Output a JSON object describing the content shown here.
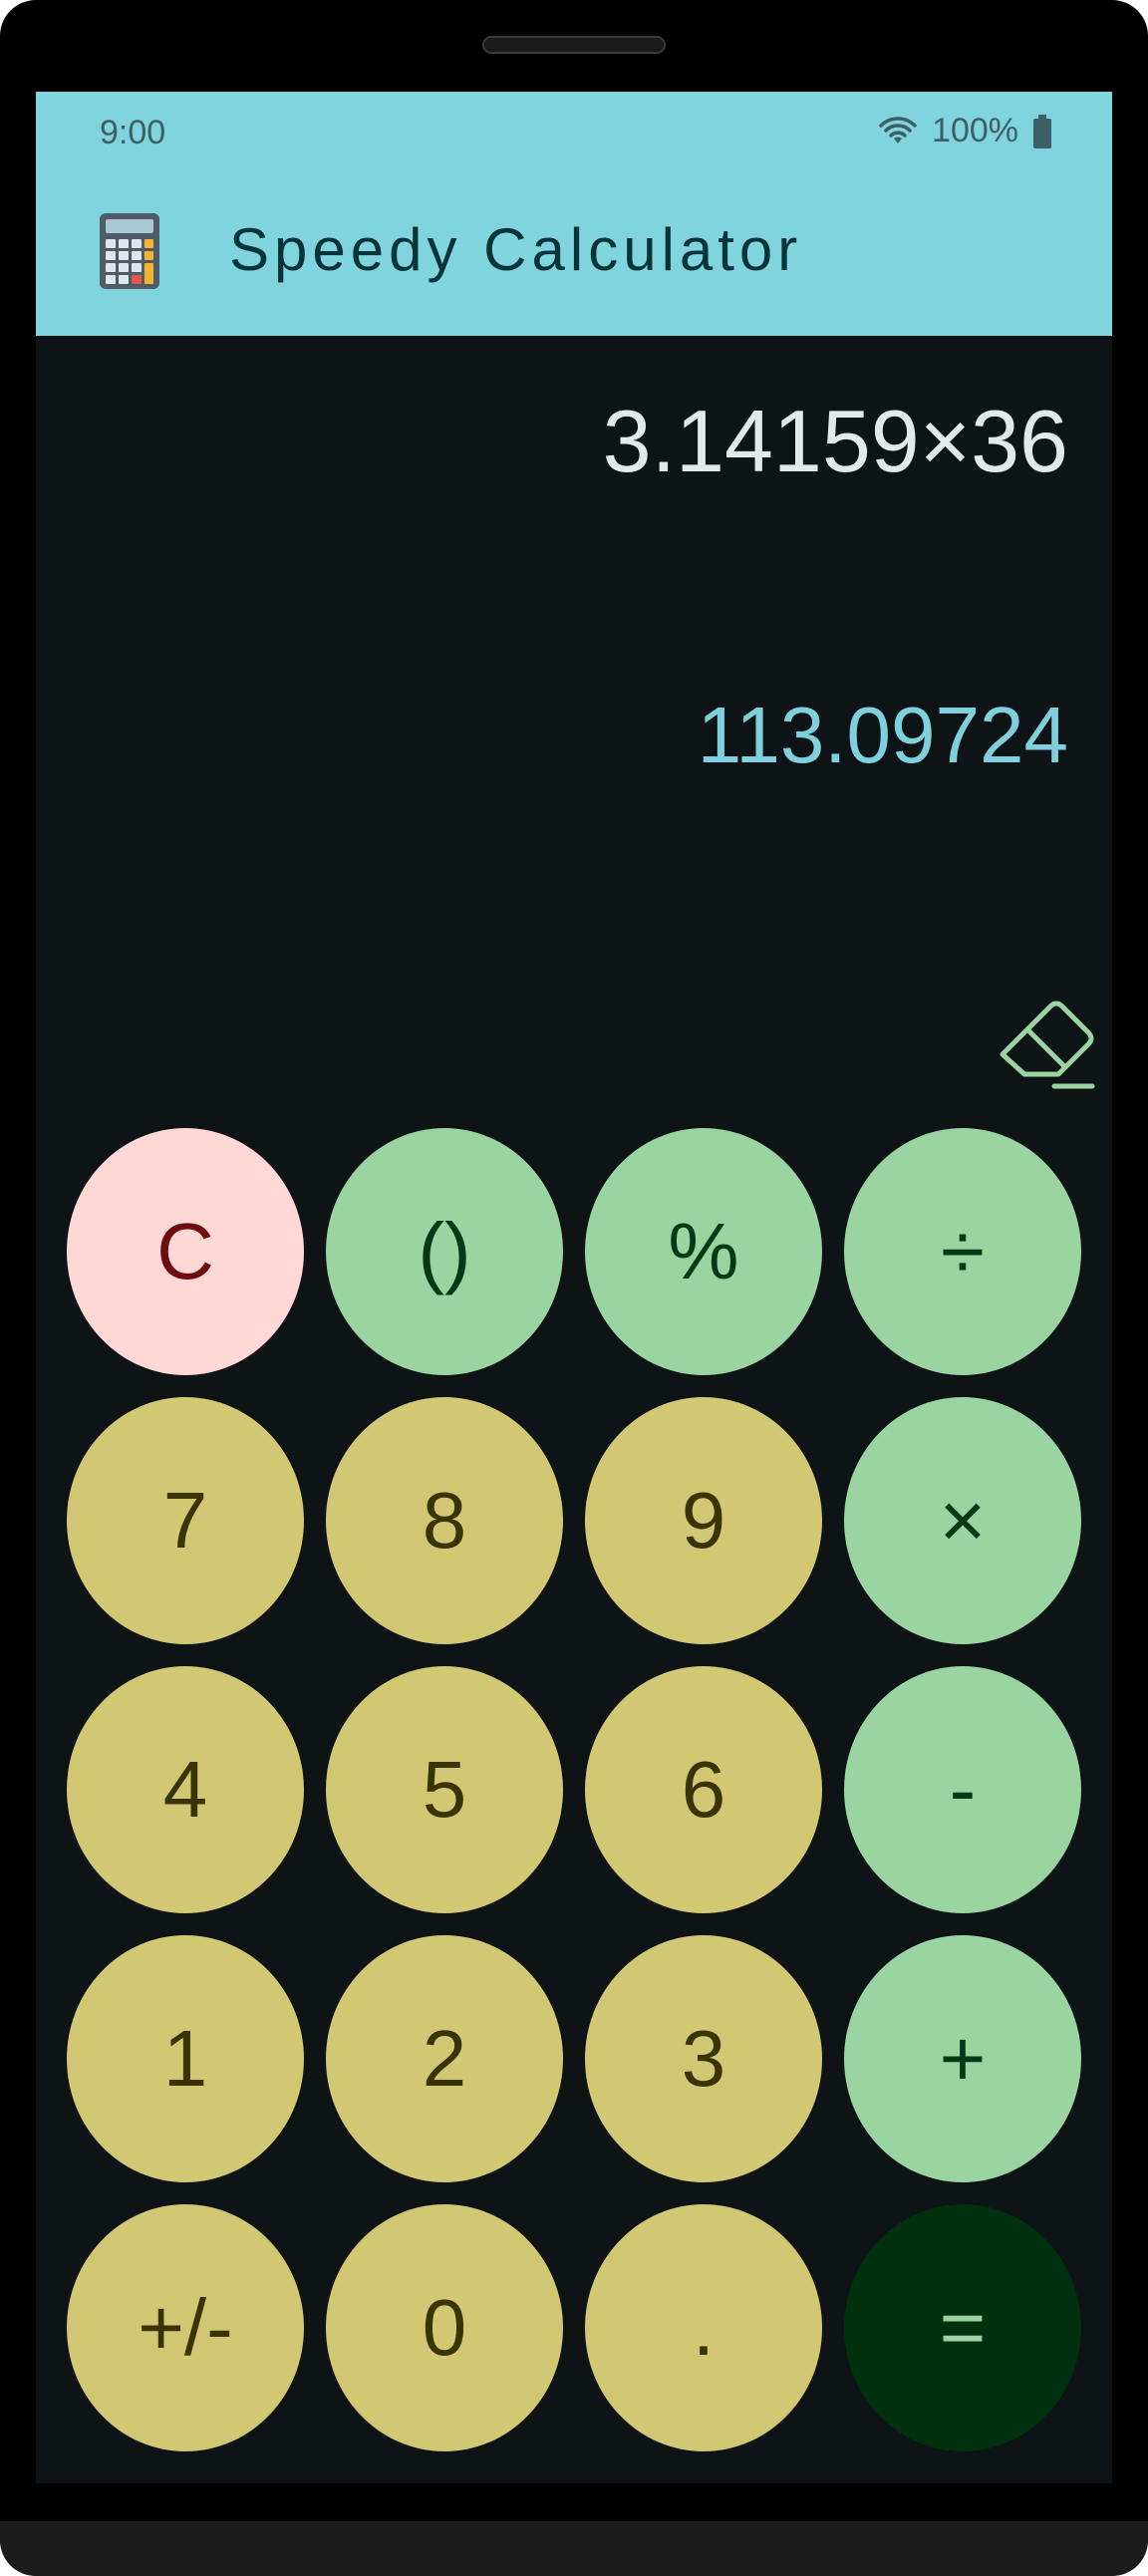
{
  "status_bar": {
    "time": "9:00",
    "battery": "100%"
  },
  "app_bar": {
    "title": "Speedy Calculator",
    "icon": "calculator-icon"
  },
  "display": {
    "expression": "3.14159×36",
    "result": "113.09724",
    "backspace_icon": "eraser-icon"
  },
  "keypad": {
    "rows": [
      [
        {
          "label": "C",
          "kind": "clear",
          "name": "clear-button"
        },
        {
          "label": "()",
          "kind": "op",
          "name": "parentheses-button"
        },
        {
          "label": "%",
          "kind": "op",
          "name": "percent-button"
        },
        {
          "label": "÷",
          "kind": "op",
          "name": "divide-button"
        }
      ],
      [
        {
          "label": "7",
          "kind": "num",
          "name": "digit-7-button"
        },
        {
          "label": "8",
          "kind": "num",
          "name": "digit-8-button"
        },
        {
          "label": "9",
          "kind": "num",
          "name": "digit-9-button"
        },
        {
          "label": "×",
          "kind": "op",
          "name": "multiply-button"
        }
      ],
      [
        {
          "label": "4",
          "kind": "num",
          "name": "digit-4-button"
        },
        {
          "label": "5",
          "kind": "num",
          "name": "digit-5-button"
        },
        {
          "label": "6",
          "kind": "num",
          "name": "digit-6-button"
        },
        {
          "label": "-",
          "kind": "op",
          "name": "subtract-button"
        }
      ],
      [
        {
          "label": "1",
          "kind": "num",
          "name": "digit-1-button"
        },
        {
          "label": "2",
          "kind": "num",
          "name": "digit-2-button"
        },
        {
          "label": "3",
          "kind": "num",
          "name": "digit-3-button"
        },
        {
          "label": "+",
          "kind": "op",
          "name": "add-button"
        }
      ],
      [
        {
          "label": "+/-",
          "kind": "num",
          "name": "toggle-sign-button"
        },
        {
          "label": "0",
          "kind": "num",
          "name": "digit-0-button"
        },
        {
          "label": ".",
          "kind": "num",
          "name": "decimal-button"
        },
        {
          "label": "=",
          "kind": "equals",
          "name": "equals-button"
        }
      ]
    ]
  },
  "colors": {
    "app_bar": "#80d4de",
    "background": "#0e1316",
    "number_key": "#d2c873",
    "operator_key": "#99d4a1",
    "clear_key": "#ffd8d6",
    "equals_key": "#00310f",
    "result_text": "#7fd0dc"
  }
}
